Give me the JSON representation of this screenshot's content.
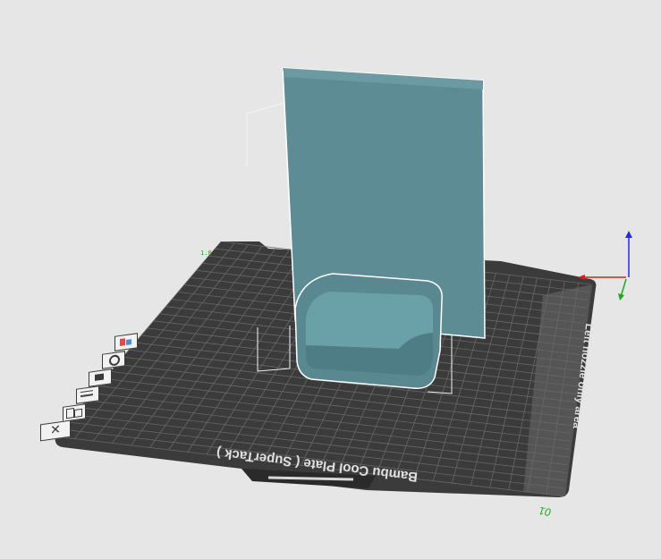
{
  "plate": {
    "name": "Bambu Cool Plate ( SuperTack )",
    "left_area_label": "Left nozzle only area",
    "plate_number": "01",
    "corner_label": "1.0",
    "colors": {
      "background": "#e6e6e6",
      "plate": "#3b3b3b",
      "grid": "#6b6b6b",
      "side_strip": "#5a5a5a",
      "model": "#5f8f96",
      "selection": "#ffffff"
    }
  },
  "toolbar": {
    "items": [
      {
        "icon": "auto-orient-icon"
      },
      {
        "icon": "settings-gear-icon"
      },
      {
        "icon": "camera-view-icon"
      },
      {
        "icon": "layers-icon"
      },
      {
        "icon": "arrange-icon"
      },
      {
        "icon": "close-x-icon"
      }
    ]
  },
  "axes": {
    "x_color": "#d62020",
    "y_color": "#1fa81f",
    "z_color": "#1f2fd6"
  }
}
